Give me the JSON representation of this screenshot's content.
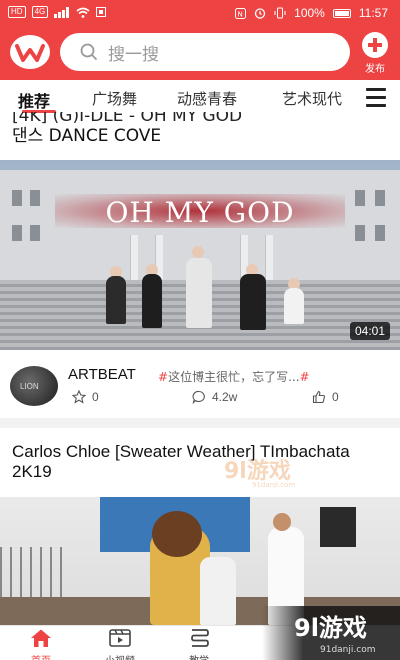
{
  "status_bar": {
    "left_badge_1": "HD",
    "left_badge_2": "4G",
    "battery": "100%",
    "time": "11:57"
  },
  "header": {
    "search_placeholder": "搜一搜",
    "publish_label": "发布",
    "accent_color": "#ee4343"
  },
  "tabs": [
    {
      "label": "推荐",
      "active": true
    },
    {
      "label": "广场舞",
      "active": false
    },
    {
      "label": "动感青春",
      "active": false
    },
    {
      "label": "艺术现代",
      "active": false
    }
  ],
  "feed": [
    {
      "title_clipped": "[4K] (G)I-DLE - OH MY GOD",
      "title_line2": "댄스 DANCE COVE",
      "overlay_title": "OH MY GOD",
      "duration": "04:01",
      "author": "ARTBEAT",
      "tagline_hash": "#",
      "tagline": "这位博主很忙，忘了写...",
      "tagline_hash_end": "#",
      "likes": "0",
      "comments": "4.2w",
      "thumbs_up": "0"
    },
    {
      "title": "Carlos  Chloe [Sweater Weather] TImbachata  2K19"
    }
  ],
  "bottom_nav": [
    {
      "label": "首页",
      "active": true
    },
    {
      "label": "小视频",
      "active": false
    },
    {
      "label": "教学",
      "active": false
    }
  ],
  "watermark": {
    "text": "9l游戏",
    "sub": "91danji.com"
  }
}
